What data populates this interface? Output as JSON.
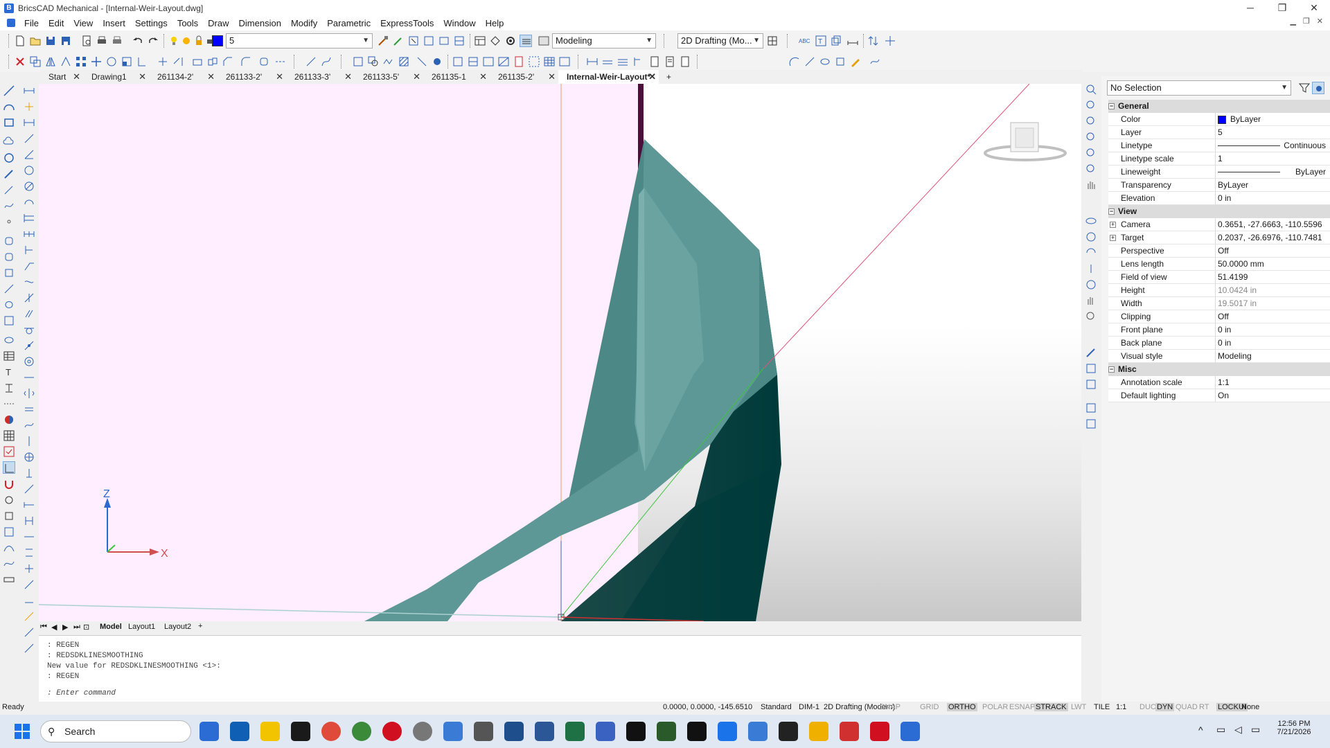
{
  "window": {
    "title": "BricsCAD Mechanical - [Internal-Weir-Layout.dwg]",
    "minimize": "─",
    "maximize": "❐",
    "close": "✕"
  },
  "menu": [
    "File",
    "Edit",
    "View",
    "Insert",
    "Settings",
    "Tools",
    "Draw",
    "Dimension",
    "Modify",
    "Parametric",
    "ExpressTools",
    "Window",
    "Help"
  ],
  "toolbar": {
    "layer_value": "5",
    "visual_style": "Modeling",
    "workspace": "2D Drafting (Mo...",
    "color_swatch": "#0000ff"
  },
  "tabs": [
    {
      "label": "Start"
    },
    {
      "label": "Drawing1"
    },
    {
      "label": "261134-2'"
    },
    {
      "label": "261133-2'"
    },
    {
      "label": "261133-3'"
    },
    {
      "label": "261133-5'"
    },
    {
      "label": "261135-1"
    },
    {
      "label": "261135-2'"
    },
    {
      "label": "Internal-Weir-Layout*"
    }
  ],
  "tab_add": "+",
  "axes": {
    "z": "Z",
    "x": "X"
  },
  "layout_tabs": [
    "Model",
    "Layout1",
    "Layout2"
  ],
  "layout_add": "+",
  "command_lines": [
    ": REGEN",
    ": REDSDKLINESMOOTHING",
    "New value for REDSDKLINESMOOTHING <1>:",
    ": REGEN"
  ],
  "command_prompt": ": Enter command",
  "status": {
    "ready": "Ready",
    "coords": "0.0000, 0.0000, -145.6510",
    "items": [
      "Standard",
      "DIM-1",
      "2D Drafting (Modern)",
      "SNAP",
      "GRID",
      "ORTHO",
      "POLAR",
      "ESNAP",
      "STRACK",
      "LWT",
      "TILE",
      "1:1",
      "DUCS",
      "DYN",
      "QUAD",
      "RT",
      "LOCKUI",
      "None"
    ]
  },
  "properties": {
    "selection": "No Selection",
    "groups": [
      {
        "name": "General",
        "rows": [
          {
            "k": "Color",
            "v": "ByLayer",
            "swatch": "#0000ff"
          },
          {
            "k": "Layer",
            "v": "5"
          },
          {
            "k": "Linetype",
            "v": "Continuous",
            "line": true
          },
          {
            "k": "Linetype scale",
            "v": "1"
          },
          {
            "k": "Lineweight",
            "v": "ByLayer",
            "line": true
          },
          {
            "k": "Transparency",
            "v": "ByLayer"
          },
          {
            "k": "Elevation",
            "v": "0 in"
          }
        ]
      },
      {
        "name": "View",
        "rows": [
          {
            "k": "Camera",
            "v": "0.3651, -27.6663, -110.5596",
            "expand": true
          },
          {
            "k": "Target",
            "v": "0.2037, -26.6976, -110.7481",
            "expand": true
          },
          {
            "k": "Perspective",
            "v": "Off"
          },
          {
            "k": "Lens length",
            "v": "50.0000 mm"
          },
          {
            "k": "Field of view",
            "v": "51.4199"
          },
          {
            "k": "Height",
            "v": "10.0424 in",
            "gray": true
          },
          {
            "k": "Width",
            "v": "19.5017 in",
            "gray": true
          },
          {
            "k": "Clipping",
            "v": "Off"
          },
          {
            "k": "Front plane",
            "v": "0 in"
          },
          {
            "k": "Back plane",
            "v": "0 in"
          },
          {
            "k": "Visual style",
            "v": "Modeling"
          }
        ]
      },
      {
        "name": "Misc",
        "rows": [
          {
            "k": "Annotation scale",
            "v": "1:1"
          },
          {
            "k": "Default lighting",
            "v": "On"
          }
        ]
      }
    ]
  },
  "taskbar": {
    "search": "Search",
    "time": "12:56 PM",
    "date": "7/21/2026"
  }
}
